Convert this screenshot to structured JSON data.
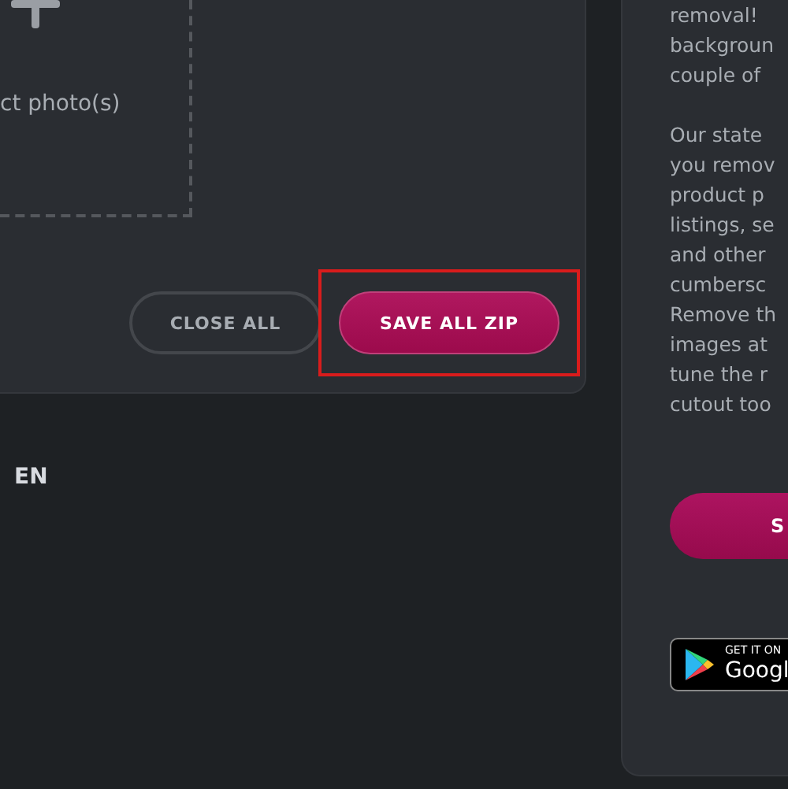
{
  "upload": {
    "hint": "ct photo(s)"
  },
  "actions": [
    {
      "label": "CLOSE ALL",
      "kind": "outline",
      "highlighted": false
    },
    {
      "label": "SAVE ALL ZIP",
      "kind": "primary",
      "highlighted": true
    }
  ],
  "language": "EN",
  "info": {
    "paragraphs": [
      [
        "removal!",
        "backgroun",
        "couple of"
      ],
      [
        "Our state",
        "you remov",
        "product p",
        "listings, se",
        "and other",
        "cumbersc",
        "Remove th",
        "images at",
        "tune the r",
        "cutout too"
      ]
    ],
    "button": "S",
    "store_badge": {
      "caption": "GET IT ON",
      "name": "Googl"
    }
  }
}
